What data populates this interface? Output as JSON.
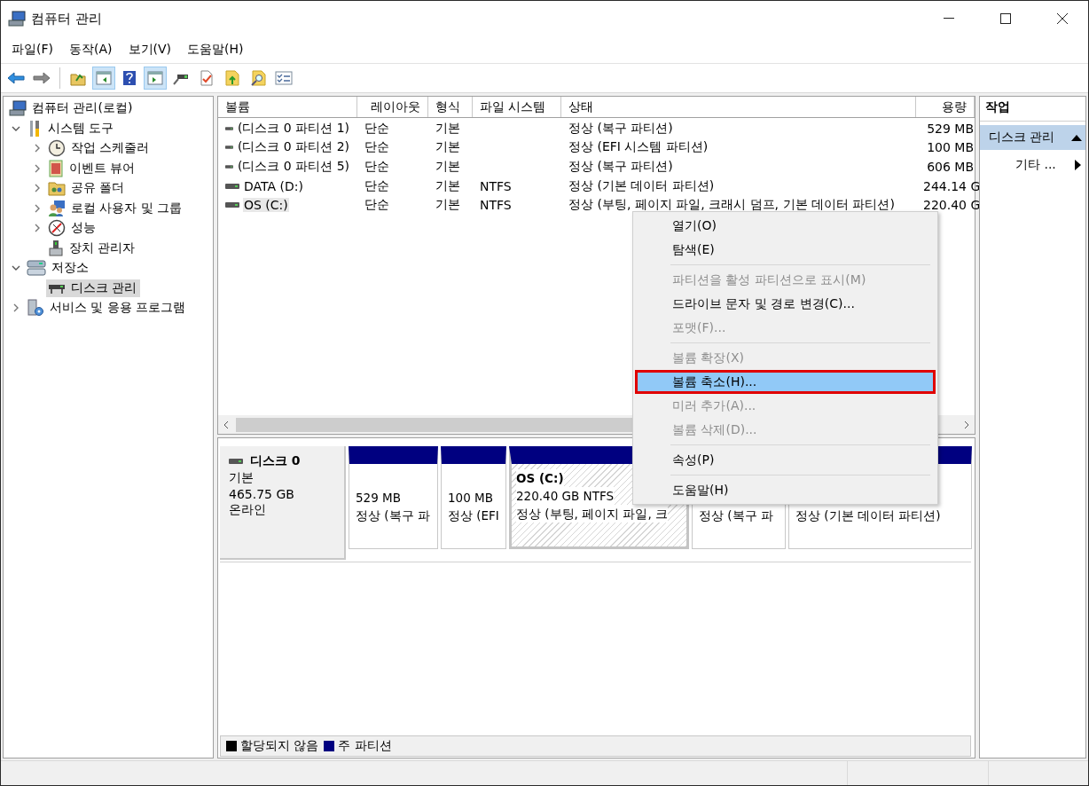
{
  "window": {
    "title": "컴퓨터 관리"
  },
  "menu": [
    "파일(F)",
    "동작(A)",
    "보기(V)",
    "도움말(H)"
  ],
  "toolbar": [
    {
      "kind": "back",
      "pressed": false
    },
    {
      "kind": "forward",
      "pressed": false
    },
    {
      "kind": "separator"
    },
    {
      "kind": "up-folder",
      "pressed": false
    },
    {
      "kind": "tree-pane",
      "pressed": true
    },
    {
      "kind": "help",
      "pressed": false
    },
    {
      "kind": "action-pane",
      "pressed": true
    },
    {
      "kind": "connect",
      "pressed": false
    },
    {
      "kind": "check-doc",
      "pressed": false
    },
    {
      "kind": "export",
      "pressed": false
    },
    {
      "kind": "search-doc",
      "pressed": false
    },
    {
      "kind": "checklist",
      "pressed": false
    }
  ],
  "tree": {
    "items": [
      {
        "label": "컴퓨터 관리(로컬)",
        "kind": "computer",
        "expandable": false,
        "selected": false,
        "children": [
          {
            "label": "시스템 도구",
            "kind": "tools",
            "expandable": true,
            "expanded": true,
            "selected": false,
            "children": [
              {
                "label": "작업 스케줄러",
                "kind": "clock",
                "expandable": true,
                "expanded": false,
                "selected": false
              },
              {
                "label": "이벤트 뷰어",
                "kind": "log",
                "expandable": true,
                "expanded": false,
                "selected": false
              },
              {
                "label": "공유 폴더",
                "kind": "share",
                "expandable": true,
                "expanded": false,
                "selected": false
              },
              {
                "label": "로컬 사용자 및 그룹",
                "kind": "users",
                "expandable": true,
                "expanded": false,
                "selected": false
              },
              {
                "label": "성능",
                "kind": "gauge",
                "expandable": true,
                "expanded": false,
                "selected": false
              },
              {
                "label": "장치 관리자",
                "kind": "device",
                "expandable": false,
                "selected": false
              }
            ]
          },
          {
            "label": "저장소",
            "kind": "storage",
            "expandable": true,
            "expanded": true,
            "selected": false,
            "children": [
              {
                "label": "디스크 관리",
                "kind": "disk",
                "expandable": false,
                "selected": true
              }
            ]
          },
          {
            "label": "서비스 및 응용 프로그램",
            "kind": "services",
            "expandable": true,
            "expanded": false,
            "selected": false
          }
        ]
      }
    ]
  },
  "volumes": {
    "columns": [
      "볼륨",
      "레이아웃",
      "형식",
      "파일 시스템",
      "상태",
      "용량"
    ],
    "rows": [
      {
        "volume": "(디스크 0 파티션 1)",
        "layout": "단순",
        "type": "기본",
        "status": "정상 (복구 파티션)",
        "capacity": "529 MB",
        "selected": false
      },
      {
        "volume": "(디스크 0 파티션 2)",
        "layout": "단순",
        "type": "기본",
        "status": "정상 (EFI 시스템 파티션)",
        "capacity": "100 MB",
        "selected": false
      },
      {
        "volume": "(디스크 0 파티션 5)",
        "layout": "단순",
        "type": "기본",
        "status": "정상 (복구 파티션)",
        "capacity": "606 MB",
        "selected": false
      },
      {
        "volume": "DATA (D:)",
        "layout": "단순",
        "type": "기본",
        "file_system": "NTFS",
        "status": "정상 (기본 데이터 파티션)",
        "capacity": "244.14 G",
        "selected": false
      },
      {
        "volume": "OS (C:)",
        "layout": "단순",
        "type": "기본",
        "file_system": "NTFS",
        "status": "정상 (부팅, 페이지 파일, 크래시 덤프, 기본 데이터 파티션)",
        "capacity": "220.40 G",
        "selected": true
      }
    ]
  },
  "disk_map": {
    "disk": {
      "name": "디스크 0",
      "type": "기본",
      "size": "465.75 GB",
      "state": "온라인"
    },
    "partitions": [
      {
        "size": "529 MB",
        "status": "정상 (복구 파",
        "selected": false
      },
      {
        "size": "100 MB",
        "status": "정상 (EFI",
        "selected": false
      },
      {
        "name": "OS  (C:)",
        "size": "220.40 GB NTFS",
        "status": "정상 (부팅, 페이지 파일, 크",
        "selected": true
      },
      {
        "status": "정상 (복구 파",
        "selected": false
      },
      {
        "status": "정상 (기본 데이터 파티션)",
        "selected": false
      }
    ],
    "legend": [
      {
        "label": "할당되지 않음",
        "color": "#000000"
      },
      {
        "label": "주 파티션",
        "color": "#000080"
      }
    ]
  },
  "actions": {
    "title": "작업",
    "items": [
      {
        "label": "디스크 관리",
        "kind": "section",
        "selected": true
      },
      {
        "label": "기타 ...",
        "kind": "submenu",
        "selected": false
      }
    ]
  },
  "context_menu": {
    "items": [
      {
        "kind": "item",
        "label": "열기(O)",
        "disabled": false,
        "selected": false,
        "outlined": false
      },
      {
        "kind": "item",
        "label": "탐색(E)",
        "disabled": false,
        "selected": false,
        "outlined": false
      },
      {
        "kind": "separator"
      },
      {
        "kind": "item",
        "label": "파티션을 활성 파티션으로 표시(M)",
        "disabled": true,
        "selected": false,
        "outlined": false
      },
      {
        "kind": "item",
        "label": "드라이브 문자 및 경로 변경(C)...",
        "disabled": false,
        "selected": false,
        "outlined": false
      },
      {
        "kind": "item",
        "label": "포맷(F)...",
        "disabled": true,
        "selected": false,
        "outlined": false
      },
      {
        "kind": "separator"
      },
      {
        "kind": "item",
        "label": "볼륨 확장(X)",
        "disabled": true,
        "selected": false,
        "outlined": false
      },
      {
        "kind": "item",
        "label": "볼륨 축소(H)...",
        "disabled": false,
        "selected": true,
        "outlined": true
      },
      {
        "kind": "item",
        "label": "미러 추가(A)...",
        "disabled": true,
        "selected": false,
        "outlined": false
      },
      {
        "kind": "item",
        "label": "볼륨 삭제(D)...",
        "disabled": true,
        "selected": false,
        "outlined": false
      },
      {
        "kind": "separator"
      },
      {
        "kind": "item",
        "label": "속성(P)",
        "disabled": false,
        "selected": false,
        "outlined": false
      },
      {
        "kind": "separator"
      },
      {
        "kind": "item",
        "label": "도움말(H)",
        "disabled": false,
        "selected": false,
        "outlined": false
      }
    ]
  }
}
